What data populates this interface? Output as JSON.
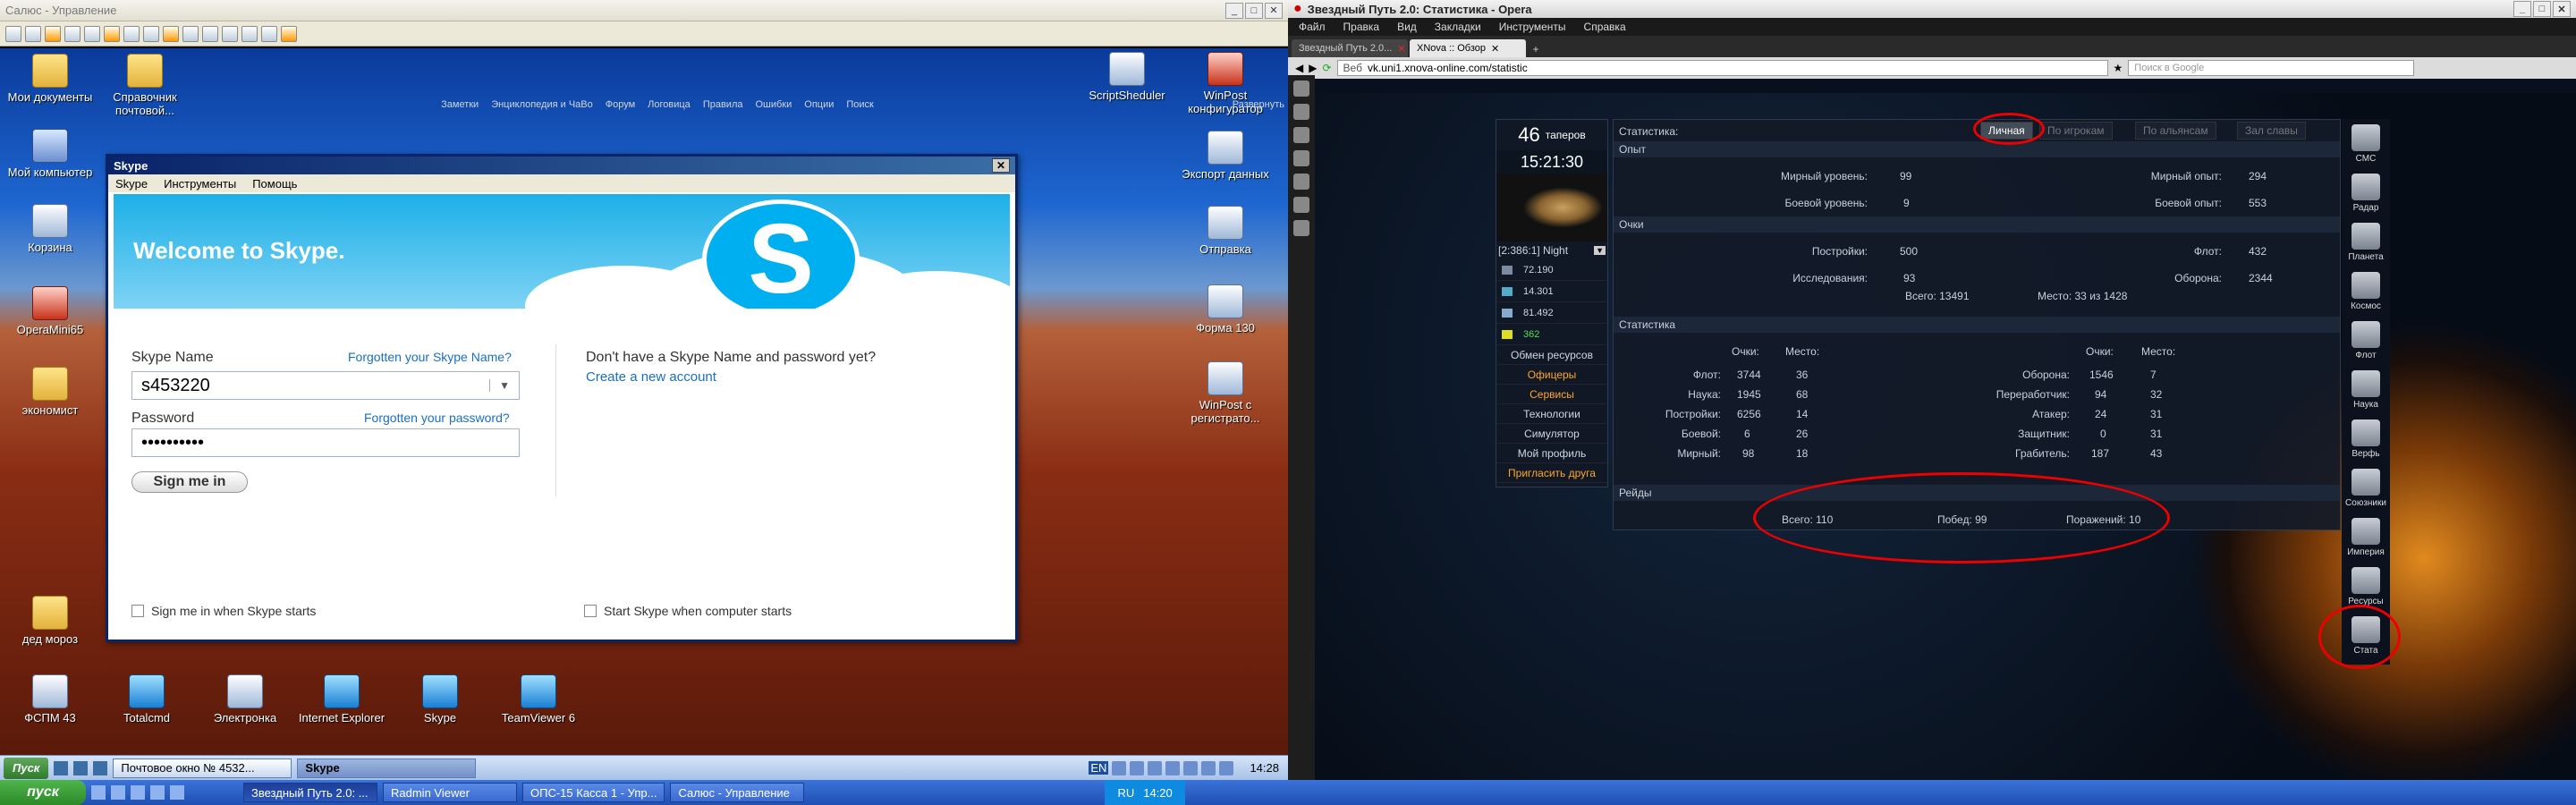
{
  "left_window": {
    "title": "Салюс - Управление",
    "controls": [
      "_",
      "□",
      "✕"
    ]
  },
  "desktop_icons": [
    {
      "label": "Мои документы",
      "type": "fold"
    },
    {
      "label": "Справочник почтовой...",
      "type": "fold"
    },
    {
      "label": "Мой компьютер",
      "type": "pc"
    },
    {
      "label": "Корзина",
      "type": "app"
    },
    {
      "label": "OperaMini65",
      "type": "red"
    },
    {
      "label": "экономист",
      "type": "fold"
    },
    {
      "label": "дед мороз",
      "type": "fold"
    },
    {
      "label": "ФСПМ 43",
      "type": "app"
    },
    {
      "label": "Totalcmd",
      "type": "blu"
    },
    {
      "label": "Электронка",
      "type": "app"
    },
    {
      "label": "Internet Explorer",
      "type": "blu"
    },
    {
      "label": "Skype",
      "type": "blu"
    },
    {
      "label": "TeamViewer 6",
      "type": "blu"
    },
    {
      "label": "ScriptSheduler",
      "type": "app"
    },
    {
      "label": "WinPost конфигуратор",
      "type": "app"
    },
    {
      "label": "Экспорт данных",
      "type": "app"
    },
    {
      "label": "Отправка",
      "type": "app"
    },
    {
      "label": "Форма 130",
      "type": "app"
    },
    {
      "label": "WinPost с регистрато...",
      "type": "app"
    }
  ],
  "skype": {
    "title": "Skype",
    "menu": [
      "Skype",
      "Инструменты",
      "Помощь"
    ],
    "welcome": "Welcome to Skype.",
    "name_label": "Skype Name",
    "forgot_name": "Forgotten your Skype Name?",
    "name_value": "s453220",
    "password_label": "Password",
    "forgot_password": "Forgotten your password?",
    "password_value": "••••••••••",
    "sign_in": "Sign me in",
    "no_account": "Don't have a Skype Name and password yet?",
    "create": "Create a new account",
    "chk1": "Sign me in when Skype starts",
    "chk2": "Start Skype when computer starts"
  },
  "left_taskbar": {
    "start": "Пуск",
    "buttons": [
      "Почтовое окно № 4532...",
      "Skype"
    ],
    "lang": "EN",
    "time": "14:28"
  },
  "bottom_taskbar": {
    "start": "пуск",
    "buttons": [
      "Звездный Путь 2.0: ...",
      "Radmin Viewer",
      "ОПС-15 Касса 1 - Упр...",
      "Салюс - Управление"
    ],
    "lang": "RU",
    "time": "14:20"
  },
  "opera": {
    "title": "Звездный Путь 2.0: Статистика - Opera",
    "menu": [
      "Файл",
      "Правка",
      "Вид",
      "Закладки",
      "Инструменты",
      "Справка"
    ],
    "tabs": [
      "Звездный Путь 2.0...",
      "XNova :: Обзор"
    ],
    "url_prefix": "Веб",
    "url": "vk.uni1.xnova-online.com/statistic",
    "search_placeholder": "Поиск в Google"
  },
  "game": {
    "nav": [
      "Заметки",
      "Энциклопедия и ЧаВо",
      "Форум",
      "Логовица",
      "Правила",
      "Ошибки",
      "Опции",
      "Поиск"
    ],
    "expand": "Развернуть",
    "players_count": "46",
    "players_label": "таперов",
    "time": "15:21:30",
    "planet": "[2:386:1] Night",
    "resources": [
      "72.190",
      "14.301",
      "81.492",
      "362"
    ],
    "left_menu": [
      "Обмен ресурсов",
      "Офицеры",
      "Сервисы",
      "Технологии",
      "Симулятор",
      "Мой профиль",
      "Пригласить друга"
    ],
    "stats_title": "Статистика:",
    "stat_tabs": [
      "Личная",
      "По игрокам",
      "По альянсам",
      "Зал славы"
    ],
    "sec_exp": "Опыт",
    "exp": [
      {
        "k": "Мирный уровень:",
        "v": "99",
        "k2": "Мирный опыт:",
        "v2": "294"
      },
      {
        "k": "Боевой уровень:",
        "v": "9",
        "k2": "Боевой опыт:",
        "v2": "553"
      }
    ],
    "sec_points": "Очки",
    "points": [
      {
        "k": "Постройки:",
        "v": "500",
        "k2": "Флот:",
        "v2": "432"
      },
      {
        "k": "Исследования:",
        "v": "93",
        "k2": "Оборона:",
        "v2": "2344"
      }
    ],
    "points_total": "Всего: 13491",
    "points_place": "Место: 33 из 1428",
    "sec_stat": "Статистика",
    "col_points": "Очки:",
    "col_place": "Место:",
    "stat_left": [
      {
        "k": "Флот:",
        "p": "3744",
        "m": "36"
      },
      {
        "k": "Наука:",
        "p": "1945",
        "m": "68"
      },
      {
        "k": "Постройки:",
        "p": "6256",
        "m": "14"
      },
      {
        "k": "Боевой:",
        "p": "6",
        "m": "26"
      },
      {
        "k": "Мирный:",
        "p": "98",
        "m": "18"
      }
    ],
    "stat_right": [
      {
        "k": "Оборона:",
        "p": "1546",
        "m": "7"
      },
      {
        "k": "Переработчик:",
        "p": "94",
        "m": "32"
      },
      {
        "k": "Атакер:",
        "p": "24",
        "m": "31"
      },
      {
        "k": "Защитник:",
        "p": "0",
        "m": "31"
      },
      {
        "k": "Грабитель:",
        "p": "187",
        "m": "43"
      }
    ],
    "sec_raids": "Рейды",
    "raids": [
      "Всего: 110",
      "Побед: 99",
      "Поражений: 10"
    ],
    "right_menu": [
      "СМС",
      "Радар",
      "Планета",
      "Космос",
      "Флот",
      "Наука",
      "Верфь",
      "Союзники",
      "Империя",
      "Ресурсы",
      "Стата"
    ]
  }
}
